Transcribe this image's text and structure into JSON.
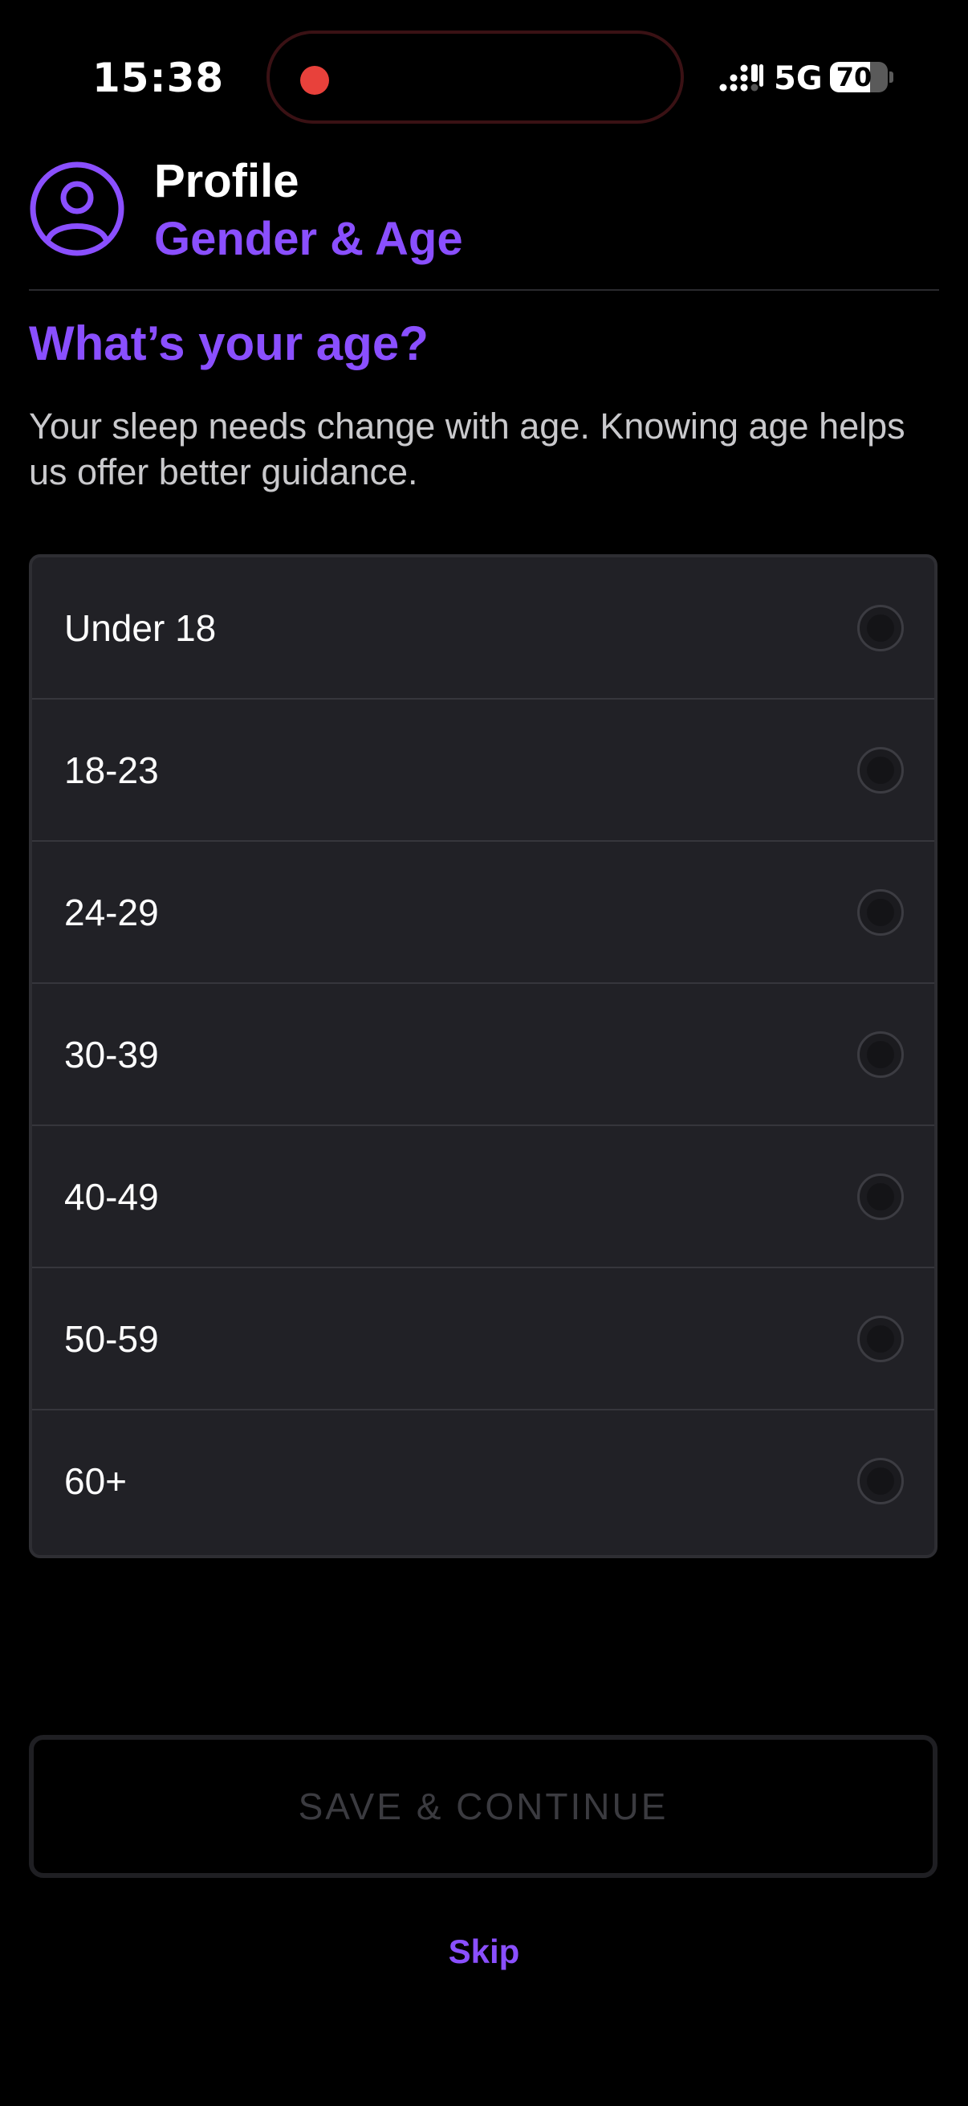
{
  "status_bar": {
    "time": "15:38",
    "network": "5G",
    "battery_level": "70",
    "battery_fraction": 0.7,
    "recording_indicator_color": "#e8413b",
    "icons": [
      "recording-dot-icon",
      "signal-icon",
      "battery-icon"
    ]
  },
  "header": {
    "title": "Profile",
    "subtitle": "Gender & Age",
    "icon": "profile-icon"
  },
  "question": {
    "heading": "What’s your age?",
    "description": "Your sleep needs change with age. Knowing age helps us offer better guidance."
  },
  "options": [
    {
      "label": "Under 18",
      "selected": false
    },
    {
      "label": "18-23",
      "selected": false
    },
    {
      "label": "24-29",
      "selected": false
    },
    {
      "label": "30-39",
      "selected": false
    },
    {
      "label": "40-49",
      "selected": false
    },
    {
      "label": "50-59",
      "selected": false
    },
    {
      "label": "60+",
      "selected": false
    }
  ],
  "actions": {
    "save_label": "SAVE & CONTINUE",
    "save_enabled": false,
    "skip_label": "Skip"
  },
  "colors": {
    "accent": "#8a4fff",
    "background": "#000000",
    "card": "#212126"
  }
}
